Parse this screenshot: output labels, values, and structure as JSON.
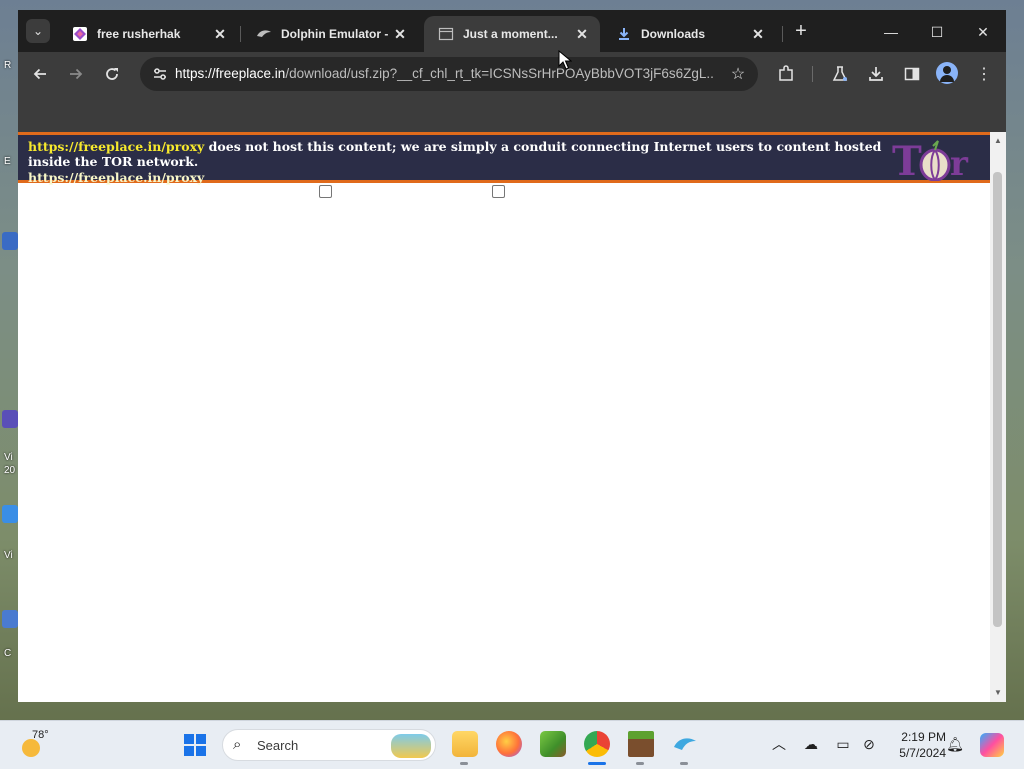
{
  "desktop": {
    "labels": [
      "R",
      "E",
      "Vi",
      "20",
      "Vi",
      "C"
    ]
  },
  "browser": {
    "tabs": [
      {
        "title": "free rusherhak",
        "active": false,
        "favicon": "rusherhack-favicon-icon"
      },
      {
        "title": "Dolphin Emulator - D",
        "active": false,
        "favicon": "dolphin-favicon-icon"
      },
      {
        "title": "Just a moment...",
        "active": true,
        "favicon": "cloudflare-page-favicon-icon"
      },
      {
        "title": "Downloads",
        "active": false,
        "favicon": "download-favicon-icon"
      }
    ],
    "window_controls": {
      "minimize": "—",
      "maximize": "☐",
      "close": "✕"
    },
    "toolbar": {
      "url_host": "https://freeplace.in",
      "url_path": "/download/usf.zip?__cf_chl_rt_tk=ICSNsSrHrPOAyBbbVOT3jF6s6ZgL...",
      "icons": [
        "back-icon",
        "forward-icon",
        "reload-icon",
        "site-info-icon",
        "bookmark-star-icon",
        "extensions-icon",
        "labs-flask-icon",
        "download-icon",
        "side-panel-icon",
        "profile-avatar-icon",
        "menu-kebab-icon"
      ]
    }
  },
  "page": {
    "banner": {
      "link_text": "https://freeplace.in/proxy",
      "message": " does not host this content; we are simply a conduit connecting Internet users to content hosted inside the TOR network."
    },
    "faded_notice": {
      "link_text": "https://freeplace.in/proxy",
      "message": ""
    },
    "logo_text": "Tor"
  },
  "taskbar": {
    "weather_temp": "78°",
    "search_label": "Search",
    "apps": [
      "file-explorer-icon",
      "firefox-icon",
      "minecraft-launcher-icon",
      "chrome-icon",
      "minecraft-block-icon",
      "dolphin-emulator-icon"
    ],
    "active_app": "chrome-icon",
    "tray": [
      "show-hidden-icons-chevron-icon",
      "onedrive-sync-icon",
      "display-icon",
      "network-status-icon",
      "notification-bell-icon"
    ],
    "time": "2:19 PM",
    "date": "5/7/2024"
  },
  "colors": {
    "banner_bg": "#2b2d47",
    "banner_border": "#e06a1b",
    "banner_link": "#f7e92d",
    "chrome_dark": "#1f1f1f",
    "chrome_toolbar": "#3c3c3c"
  }
}
